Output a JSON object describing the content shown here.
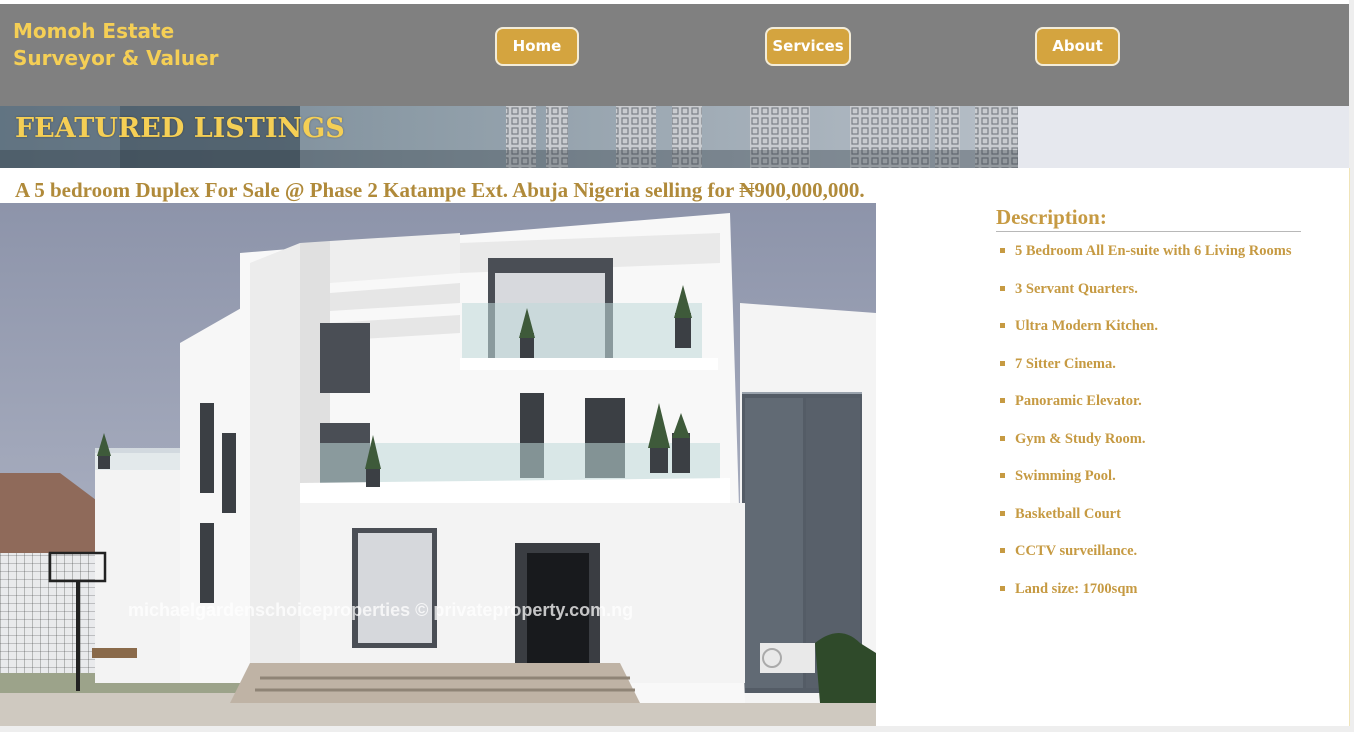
{
  "header": {
    "brand_line1": "Momoh Estate",
    "brand_line2": "Surveyor & Valuer",
    "nav": {
      "home": "Home",
      "services": "Services",
      "about": "About"
    }
  },
  "banner": {
    "title": "FEATURED LISTINGS"
  },
  "listing": {
    "title": "A 5 bedroom Duplex For Sale @ Phase 2 Katampe Ext. Abuja Nigeria selling for ₦900,000,000.",
    "photo_watermark": "michaelgardenschoiceproperties © privateproperty.com.ng",
    "description_heading": "Description:",
    "features": [
      "5 Bedroom All En-suite with 6 Living Rooms",
      "3 Servant Quarters.",
      "Ultra Modern Kitchen.",
      "7 Sitter Cinema.",
      "Panoramic Elevator.",
      "Gym & Study Room.",
      "Swimming Pool.",
      "Basketball Court",
      "CCTV surveillance.",
      "Land size: 1700sqm"
    ]
  },
  "colors": {
    "header_bg": "#808080",
    "brand_text": "#f5cf55",
    "button_bg": "#d4a43f",
    "listing_text": "#b08a3a",
    "description_text": "#c69a42"
  }
}
